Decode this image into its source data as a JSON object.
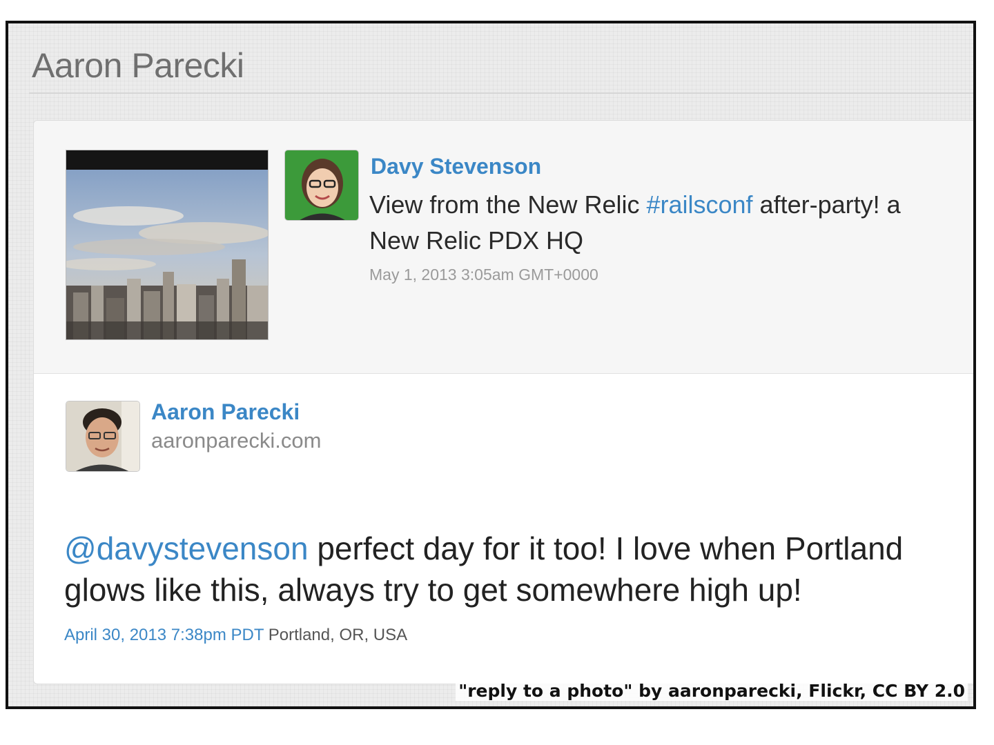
{
  "site": {
    "title": "Aaron Parecki"
  },
  "original_post": {
    "author": "Davy Stevenson",
    "text_before": "View from the New Relic ",
    "hashtag": "#railsconf",
    "text_after": " after-party! a",
    "text_line2": "New Relic PDX HQ",
    "timestamp": "May 1, 2013 3:05am GMT+0000",
    "photo_icon": "city-skyline-photo",
    "avatar_icon": "person-avatar"
  },
  "reply": {
    "author": "Aaron Parecki",
    "url": "aaronparecki.com",
    "mention": "@davystevenson",
    "text_line1": " perfect day for it too! I love when Portland",
    "text_line2": "glows like this, always try to get somewhere high up!",
    "timestamp": "April 30, 2013 7:38pm PDT",
    "location": "Portland, OR, USA",
    "avatar_icon": "person-avatar"
  },
  "credit": "\"reply to a photo\" by aaronparecki, Flickr, CC BY 2.0",
  "colors": {
    "link": "#3b87c6",
    "title": "#6f6f6f",
    "text": "#222222",
    "meta": "#9a9a9a"
  }
}
